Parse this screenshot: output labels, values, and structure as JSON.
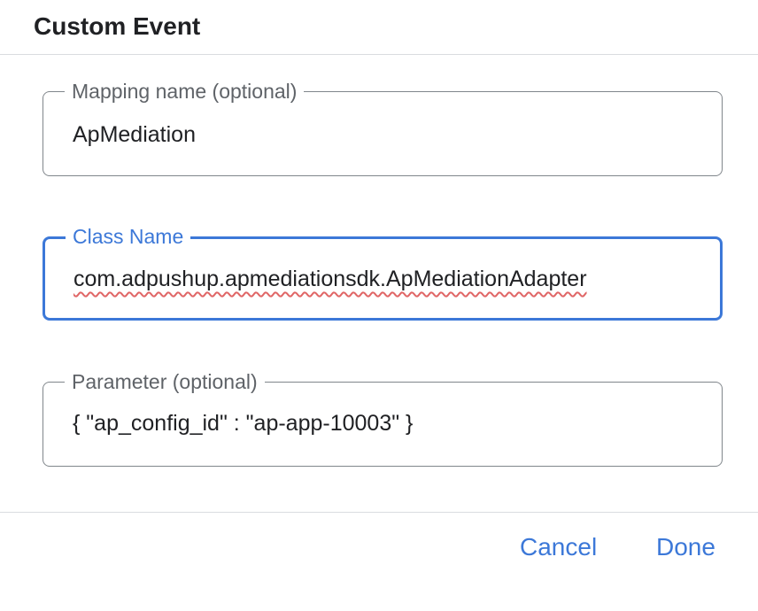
{
  "dialog": {
    "title": "Custom Event"
  },
  "fields": {
    "mapping_name": {
      "label": "Mapping name (optional)",
      "value": "ApMediation"
    },
    "class_name": {
      "label": "Class Name",
      "value": "com.adpushup.apmediationsdk.ApMediationAdapter",
      "focused": true
    },
    "parameter": {
      "label": "Parameter (optional)",
      "value": "{ \"ap_config_id\" : \"ap-app-10003\" }"
    }
  },
  "actions": {
    "cancel_label": "Cancel",
    "done_label": "Done"
  },
  "colors": {
    "accent": "#3c78d8",
    "border": "#80868b",
    "divider": "#dadce0",
    "label": "#5f6368",
    "text": "#202124",
    "spellcheck": "#e06666"
  }
}
